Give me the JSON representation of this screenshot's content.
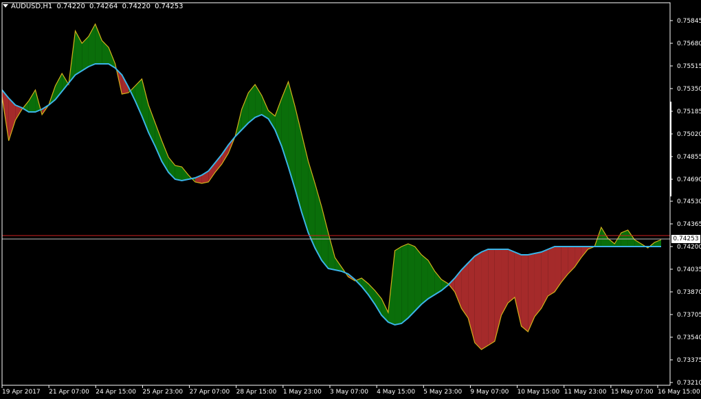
{
  "header": {
    "symbol": "AUDUSD,H1",
    "open": "0.74220",
    "high": "0.74264",
    "low": "0.74220",
    "close": "0.74253"
  },
  "price_axis": {
    "ticks": [
      "0.75845",
      "0.75680",
      "0.75515",
      "0.75350",
      "0.75185",
      "0.75020",
      "0.74855",
      "0.74690",
      "0.74530",
      "0.74365",
      "0.74200",
      "0.74035",
      "0.73870",
      "0.73705",
      "0.73540",
      "0.73375",
      "0.73210"
    ],
    "current_price": "0.74253"
  },
  "time_axis": {
    "ticks": [
      "19 Apr 2017",
      "21 Apr 07:00",
      "24 Apr 15:00",
      "25 Apr 23:00",
      "27 Apr 07:00",
      "28 Apr 15:00",
      "1 May 23:00",
      "3 May 07:00",
      "4 May 15:00",
      "5 May 23:00",
      "9 May 07:00",
      "10 May 15:00",
      "11 May 23:00",
      "15 May 07:00",
      "16 May 15:00"
    ]
  },
  "colors": {
    "background": "#000000",
    "price_line": "#d4b21a",
    "moving_average": "#3ab4e8",
    "fill_above": "#0a6e0a",
    "fill_below": "#a52a2a",
    "bid_line": "#d02020",
    "ask_line": "#c0c0c0",
    "axis": "#ffffff"
  },
  "chart_data": {
    "type": "area",
    "title": "AUDUSD,H1",
    "y_min": 0.7321,
    "y_max": 0.75845,
    "series": [
      {
        "name": "Close",
        "values": [
          0.7529,
          0.7497,
          0.7512,
          0.752,
          0.7526,
          0.7534,
          0.7516,
          0.7523,
          0.7537,
          0.7546,
          0.7538,
          0.7577,
          0.7568,
          0.7573,
          0.7582,
          0.757,
          0.7565,
          0.7553,
          0.7531,
          0.7532,
          0.7537,
          0.7542,
          0.7523,
          0.751,
          0.7497,
          0.7485,
          0.7479,
          0.7478,
          0.7472,
          0.7467,
          0.7466,
          0.7467,
          0.7474,
          0.748,
          0.7488,
          0.75,
          0.752,
          0.7532,
          0.7538,
          0.753,
          0.7519,
          0.7515,
          0.7528,
          0.754,
          0.7522,
          0.7502,
          0.7482,
          0.7466,
          0.7449,
          0.743,
          0.7412,
          0.7405,
          0.7398,
          0.7395,
          0.7397,
          0.7393,
          0.7388,
          0.7382,
          0.7372,
          0.7417,
          0.742,
          0.7422,
          0.742,
          0.7414,
          0.741,
          0.7402,
          0.7396,
          0.7393,
          0.7387,
          0.7375,
          0.7368,
          0.735,
          0.7345,
          0.7348,
          0.7351,
          0.737,
          0.7379,
          0.7383,
          0.7362,
          0.7358,
          0.7369,
          0.7375,
          0.7384,
          0.7387,
          0.7394,
          0.74,
          0.7405,
          0.7412,
          0.7418,
          0.742,
          0.7434,
          0.7426,
          0.7422,
          0.743,
          0.7432,
          0.7425,
          0.7422,
          0.7419,
          0.7423,
          0.7425
        ]
      },
      {
        "name": "Moving Average",
        "values": [
          0.7534,
          0.7528,
          0.7523,
          0.7521,
          0.7518,
          0.7518,
          0.752,
          0.7523,
          0.7527,
          0.7533,
          0.7539,
          0.7545,
          0.7548,
          0.7551,
          0.7553,
          0.7553,
          0.7553,
          0.755,
          0.7545,
          0.7536,
          0.7526,
          0.7515,
          0.7503,
          0.7493,
          0.7482,
          0.7474,
          0.7469,
          0.7468,
          0.7469,
          0.747,
          0.7472,
          0.7475,
          0.7481,
          0.7487,
          0.7494,
          0.75,
          0.7505,
          0.751,
          0.7514,
          0.7516,
          0.7513,
          0.7505,
          0.7493,
          0.7478,
          0.7462,
          0.7445,
          0.743,
          0.7419,
          0.741,
          0.7404,
          0.7403,
          0.7402,
          0.74,
          0.7396,
          0.7391,
          0.7385,
          0.7378,
          0.737,
          0.7365,
          0.7363,
          0.7364,
          0.7368,
          0.7373,
          0.7378,
          0.7382,
          0.7385,
          0.7388,
          0.7392,
          0.7397,
          0.7403,
          0.7408,
          0.7413,
          0.7416,
          0.7418,
          0.7418,
          0.7418,
          0.7418,
          0.7416,
          0.7414,
          0.7414,
          0.7415,
          0.7416,
          0.7418,
          0.742,
          0.742,
          0.742,
          0.742,
          0.742,
          0.742,
          0.742,
          0.742,
          0.742,
          0.742,
          0.742,
          0.742,
          0.742,
          0.742,
          0.742,
          0.742,
          0.742
        ]
      }
    ]
  }
}
